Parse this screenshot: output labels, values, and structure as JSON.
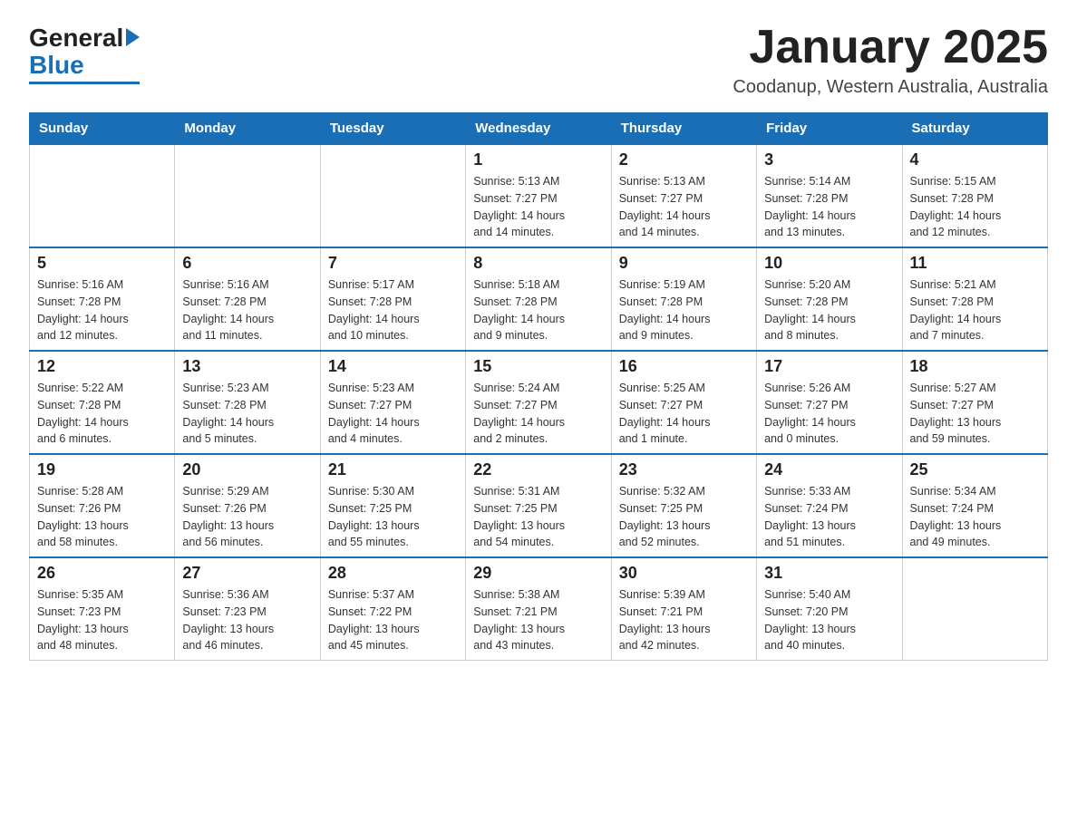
{
  "header": {
    "logo_general": "General",
    "logo_blue": "Blue",
    "main_title": "January 2025",
    "subtitle": "Coodanup, Western Australia, Australia"
  },
  "calendar": {
    "days_of_week": [
      "Sunday",
      "Monday",
      "Tuesday",
      "Wednesday",
      "Thursday",
      "Friday",
      "Saturday"
    ],
    "weeks": [
      [
        {
          "day": "",
          "info": ""
        },
        {
          "day": "",
          "info": ""
        },
        {
          "day": "",
          "info": ""
        },
        {
          "day": "1",
          "info": "Sunrise: 5:13 AM\nSunset: 7:27 PM\nDaylight: 14 hours\nand 14 minutes."
        },
        {
          "day": "2",
          "info": "Sunrise: 5:13 AM\nSunset: 7:27 PM\nDaylight: 14 hours\nand 14 minutes."
        },
        {
          "day": "3",
          "info": "Sunrise: 5:14 AM\nSunset: 7:28 PM\nDaylight: 14 hours\nand 13 minutes."
        },
        {
          "day": "4",
          "info": "Sunrise: 5:15 AM\nSunset: 7:28 PM\nDaylight: 14 hours\nand 12 minutes."
        }
      ],
      [
        {
          "day": "5",
          "info": "Sunrise: 5:16 AM\nSunset: 7:28 PM\nDaylight: 14 hours\nand 12 minutes."
        },
        {
          "day": "6",
          "info": "Sunrise: 5:16 AM\nSunset: 7:28 PM\nDaylight: 14 hours\nand 11 minutes."
        },
        {
          "day": "7",
          "info": "Sunrise: 5:17 AM\nSunset: 7:28 PM\nDaylight: 14 hours\nand 10 minutes."
        },
        {
          "day": "8",
          "info": "Sunrise: 5:18 AM\nSunset: 7:28 PM\nDaylight: 14 hours\nand 9 minutes."
        },
        {
          "day": "9",
          "info": "Sunrise: 5:19 AM\nSunset: 7:28 PM\nDaylight: 14 hours\nand 9 minutes."
        },
        {
          "day": "10",
          "info": "Sunrise: 5:20 AM\nSunset: 7:28 PM\nDaylight: 14 hours\nand 8 minutes."
        },
        {
          "day": "11",
          "info": "Sunrise: 5:21 AM\nSunset: 7:28 PM\nDaylight: 14 hours\nand 7 minutes."
        }
      ],
      [
        {
          "day": "12",
          "info": "Sunrise: 5:22 AM\nSunset: 7:28 PM\nDaylight: 14 hours\nand 6 minutes."
        },
        {
          "day": "13",
          "info": "Sunrise: 5:23 AM\nSunset: 7:28 PM\nDaylight: 14 hours\nand 5 minutes."
        },
        {
          "day": "14",
          "info": "Sunrise: 5:23 AM\nSunset: 7:27 PM\nDaylight: 14 hours\nand 4 minutes."
        },
        {
          "day": "15",
          "info": "Sunrise: 5:24 AM\nSunset: 7:27 PM\nDaylight: 14 hours\nand 2 minutes."
        },
        {
          "day": "16",
          "info": "Sunrise: 5:25 AM\nSunset: 7:27 PM\nDaylight: 14 hours\nand 1 minute."
        },
        {
          "day": "17",
          "info": "Sunrise: 5:26 AM\nSunset: 7:27 PM\nDaylight: 14 hours\nand 0 minutes."
        },
        {
          "day": "18",
          "info": "Sunrise: 5:27 AM\nSunset: 7:27 PM\nDaylight: 13 hours\nand 59 minutes."
        }
      ],
      [
        {
          "day": "19",
          "info": "Sunrise: 5:28 AM\nSunset: 7:26 PM\nDaylight: 13 hours\nand 58 minutes."
        },
        {
          "day": "20",
          "info": "Sunrise: 5:29 AM\nSunset: 7:26 PM\nDaylight: 13 hours\nand 56 minutes."
        },
        {
          "day": "21",
          "info": "Sunrise: 5:30 AM\nSunset: 7:25 PM\nDaylight: 13 hours\nand 55 minutes."
        },
        {
          "day": "22",
          "info": "Sunrise: 5:31 AM\nSunset: 7:25 PM\nDaylight: 13 hours\nand 54 minutes."
        },
        {
          "day": "23",
          "info": "Sunrise: 5:32 AM\nSunset: 7:25 PM\nDaylight: 13 hours\nand 52 minutes."
        },
        {
          "day": "24",
          "info": "Sunrise: 5:33 AM\nSunset: 7:24 PM\nDaylight: 13 hours\nand 51 minutes."
        },
        {
          "day": "25",
          "info": "Sunrise: 5:34 AM\nSunset: 7:24 PM\nDaylight: 13 hours\nand 49 minutes."
        }
      ],
      [
        {
          "day": "26",
          "info": "Sunrise: 5:35 AM\nSunset: 7:23 PM\nDaylight: 13 hours\nand 48 minutes."
        },
        {
          "day": "27",
          "info": "Sunrise: 5:36 AM\nSunset: 7:23 PM\nDaylight: 13 hours\nand 46 minutes."
        },
        {
          "day": "28",
          "info": "Sunrise: 5:37 AM\nSunset: 7:22 PM\nDaylight: 13 hours\nand 45 minutes."
        },
        {
          "day": "29",
          "info": "Sunrise: 5:38 AM\nSunset: 7:21 PM\nDaylight: 13 hours\nand 43 minutes."
        },
        {
          "day": "30",
          "info": "Sunrise: 5:39 AM\nSunset: 7:21 PM\nDaylight: 13 hours\nand 42 minutes."
        },
        {
          "day": "31",
          "info": "Sunrise: 5:40 AM\nSunset: 7:20 PM\nDaylight: 13 hours\nand 40 minutes."
        },
        {
          "day": "",
          "info": ""
        }
      ]
    ]
  }
}
